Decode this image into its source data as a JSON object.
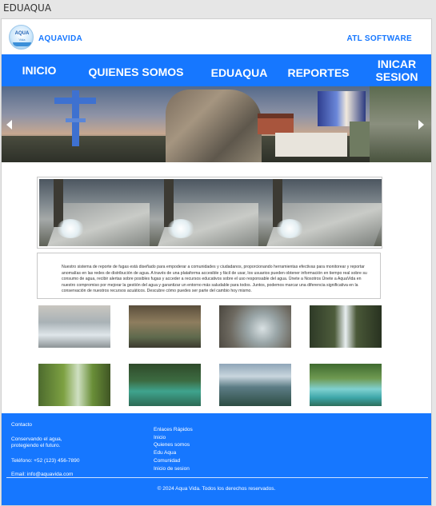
{
  "window": {
    "title": "EDUAQUA"
  },
  "header": {
    "logo_text": "AQUA",
    "logo_subtext": "Vida",
    "brand": "AQUAVIDA",
    "company": "ATL SOFTWARE"
  },
  "nav": {
    "items": [
      {
        "label": "INICIO"
      },
      {
        "label": "QUIENES SOMOS"
      },
      {
        "label": "EDUAQUA"
      },
      {
        "label": "REPORTES"
      },
      {
        "label": "INICAR SESION"
      }
    ]
  },
  "about": {
    "text": "Nuestro sistema de reporte de fugas está diseñado para empoderar a comunidades y ciudadanos, proporcionando herramientas efectivas para monitorear y reportar anomalías en las redes de distribución de agua. A través de una plataforma accesible y fácil de usar, los usuarios pueden obtener información en tiempo real sobre su consumo de agua, recibir alertas sobre posibles fugas y acceder a recursos educativos sobre el uso responsable del agua. Únete a Nosotros Únete a AquaVida en nuestro compromiso por mejorar la gestión del agua y garantizar un entorno más saludable para todos. Juntos, podemos marcar una diferencia significativa en la conservación de nuestros recursos acuáticos. Descubre cómo puedes ser parte del cambio hoy mismo."
  },
  "footer": {
    "contact_heading": "Contacto",
    "slogan_line1": "Conservando el agua,",
    "slogan_line2": "protegiendo el futuro.",
    "phone": "Teléfono: +52 (123) 456-7890",
    "email": "Email: info@aquavida.com",
    "links_heading": "Enlaces Rápidos",
    "links": [
      "Inicio",
      "Quienes somos",
      "Edu Aqua",
      "Comunidad",
      "Inicio de sesion"
    ],
    "copyright": "© 2024 Aqua Vida. Todos los derechos reservados."
  },
  "colors": {
    "primary": "#1677ff",
    "brand_text": "#1677ff"
  },
  "icons": {
    "carousel_prev": "chevron-left-icon",
    "carousel_next": "chevron-right-icon"
  }
}
